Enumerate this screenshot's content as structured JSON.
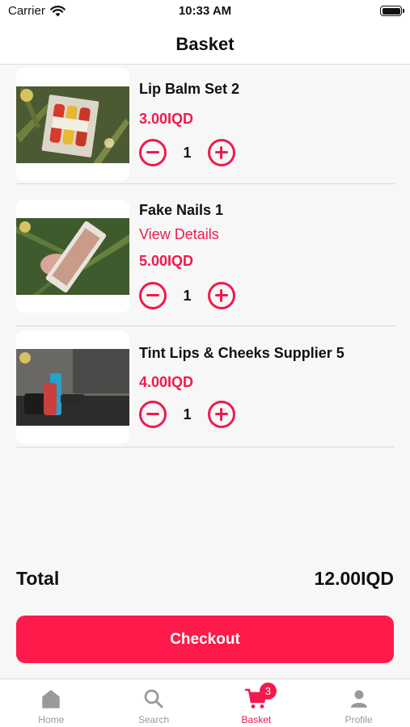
{
  "status_bar": {
    "carrier": "Carrier",
    "time": "10:33 AM"
  },
  "header": {
    "title": "Basket"
  },
  "items": [
    {
      "name": "Lip Balm Set 2",
      "price": "3.00IQD",
      "quantity": "1"
    },
    {
      "name": "Fake Nails 1",
      "link": "View Details",
      "price": "5.00IQD",
      "quantity": "1"
    },
    {
      "name": "Tint Lips & Cheeks Supplier 5",
      "price": "4.00IQD",
      "quantity": "1"
    }
  ],
  "summary": {
    "total_label": "Total",
    "total_value": "12.00IQD"
  },
  "checkout": {
    "label": "Checkout"
  },
  "tabs": [
    {
      "label": "Home",
      "icon": "home-icon"
    },
    {
      "label": "Search",
      "icon": "search-icon"
    },
    {
      "label": "Basket",
      "icon": "cart-icon",
      "badge": "3"
    },
    {
      "label": "Profile",
      "icon": "person-icon"
    }
  ],
  "colors": {
    "accent": "#ef1a4e",
    "checkout": "#fe1a4b",
    "inactive_tab": "#9a9a9a"
  }
}
